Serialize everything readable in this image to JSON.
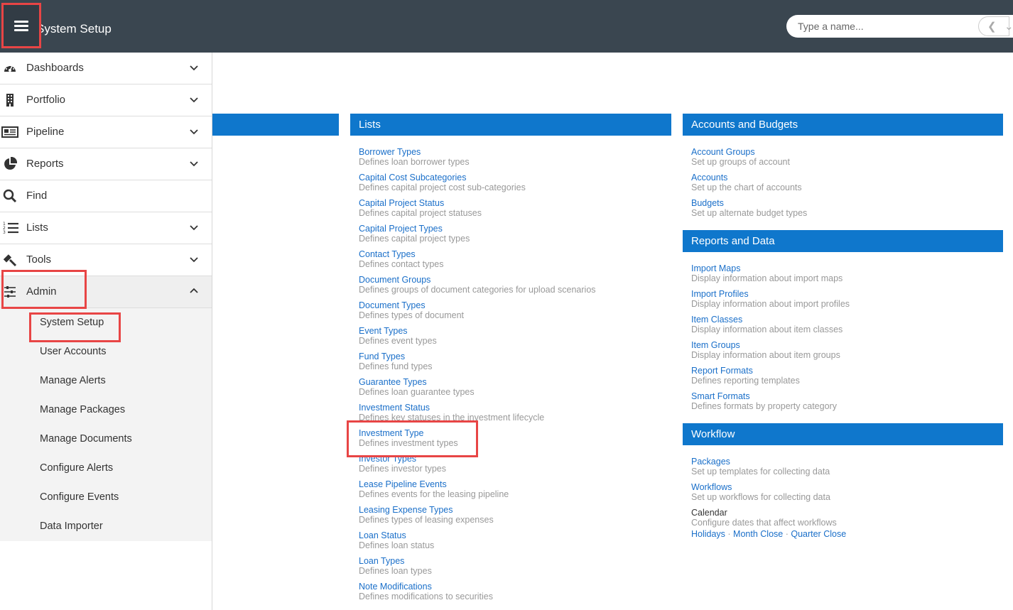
{
  "header": {
    "title": "System Setup",
    "search_placeholder": "Type a name..."
  },
  "sidebar": {
    "items": [
      {
        "label": "Dashboards",
        "icon": "dashboard-icon"
      },
      {
        "label": "Portfolio",
        "icon": "building-icon"
      },
      {
        "label": "Pipeline",
        "icon": "newspaper-icon"
      },
      {
        "label": "Reports",
        "icon": "pie-chart-icon"
      },
      {
        "label": "Find",
        "icon": "search-icon"
      },
      {
        "label": "Lists",
        "icon": "numbered-list-icon"
      },
      {
        "label": "Tools",
        "icon": "gavel-icon"
      },
      {
        "label": "Admin",
        "icon": "sliders-icon"
      }
    ],
    "admin_sub": [
      "System Setup",
      "User Accounts",
      "Manage Alerts",
      "Manage Packages",
      "Manage Documents",
      "Configure Alerts",
      "Configure Events",
      "Data Importer"
    ]
  },
  "lists": {
    "title": "Lists",
    "items": [
      {
        "name": "Borrower Types",
        "desc": "Defines loan borrower types"
      },
      {
        "name": "Capital Cost Subcategories",
        "desc": "Defines capital project cost sub-categories"
      },
      {
        "name": "Capital Project Status",
        "desc": "Defines capital project statuses"
      },
      {
        "name": "Capital Project Types",
        "desc": "Defines capital project types"
      },
      {
        "name": "Contact Types",
        "desc": "Defines contact types"
      },
      {
        "name": "Document Groups",
        "desc": "Defines groups of document categories for upload scenarios"
      },
      {
        "name": "Document Types",
        "desc": "Defines types of document"
      },
      {
        "name": "Event Types",
        "desc": "Defines event types"
      },
      {
        "name": "Fund Types",
        "desc": "Defines fund types"
      },
      {
        "name": "Guarantee Types",
        "desc": "Defines loan guarantee types"
      },
      {
        "name": "Investment Status",
        "desc": "Defines key statuses in the investment lifecycle"
      },
      {
        "name": "Investment Type",
        "desc": "Defines investment types"
      },
      {
        "name": "Investor Types",
        "desc": "Defines investor types"
      },
      {
        "name": "Lease Pipeline Events",
        "desc": "Defines events for the leasing pipeline"
      },
      {
        "name": "Leasing Expense Types",
        "desc": "Defines types of leasing expenses"
      },
      {
        "name": "Loan Status",
        "desc": "Defines loan status"
      },
      {
        "name": "Loan Types",
        "desc": "Defines loan types"
      },
      {
        "name": "Note Modifications",
        "desc": "Defines modifications to securities"
      }
    ]
  },
  "accounts": {
    "title": "Accounts and Budgets",
    "items": [
      {
        "name": "Account Groups",
        "desc": "Set up groups of account"
      },
      {
        "name": "Accounts",
        "desc": "Set up the chart of accounts"
      },
      {
        "name": "Budgets",
        "desc": "Set up alternate budget types"
      }
    ]
  },
  "reports": {
    "title": "Reports and Data",
    "items": [
      {
        "name": "Import Maps",
        "desc": "Display information about import maps"
      },
      {
        "name": "Import Profiles",
        "desc": "Display information about import profiles"
      },
      {
        "name": "Item Classes",
        "desc": "Display information about item classes"
      },
      {
        "name": "Item Groups",
        "desc": "Display information about item groups"
      },
      {
        "name": "Report Formats",
        "desc": "Defines reporting templates"
      },
      {
        "name": "Smart Formats",
        "desc": "Defines formats by property category"
      }
    ]
  },
  "workflow": {
    "title": "Workflow",
    "items": [
      {
        "name": "Packages",
        "desc": "Set up templates for collecting data"
      },
      {
        "name": "Workflows",
        "desc": "Set up workflows for collecting data"
      }
    ],
    "calendar": {
      "name": "Calendar",
      "desc": "Configure dates that affect workflows",
      "links": [
        "Holidays",
        "Month Close",
        "Quarter Close"
      ]
    }
  },
  "colors": {
    "topbar": "#3a4650",
    "section_header": "#0f77cc",
    "link": "#1a6fc9",
    "highlight": "#e84545"
  }
}
